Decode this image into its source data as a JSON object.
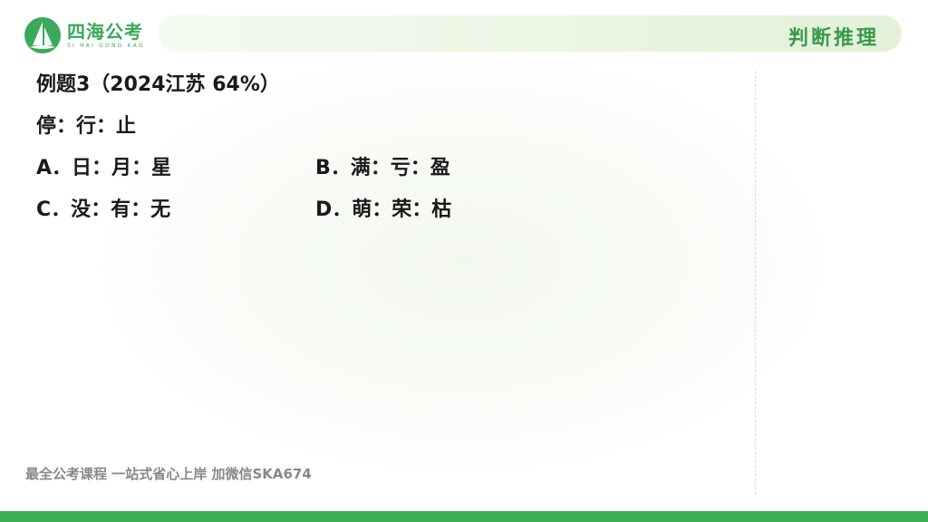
{
  "brand": {
    "name": "四海公考",
    "sub": "SI HAI GONG KAO",
    "accent": "#3aa95b"
  },
  "header": {
    "section": "判断推理"
  },
  "question": {
    "title": "例题3（2024江苏  64%）",
    "stem": "停：行：止",
    "options": [
      {
        "label": "A．日：月：星"
      },
      {
        "label": "B．满：亏：盈"
      },
      {
        "label": "C．没：有：无"
      },
      {
        "label": "D．萌：荣：枯"
      }
    ]
  },
  "footer": {
    "text": "最全公考课程 一站式省心上岸 加微信SKA674"
  }
}
